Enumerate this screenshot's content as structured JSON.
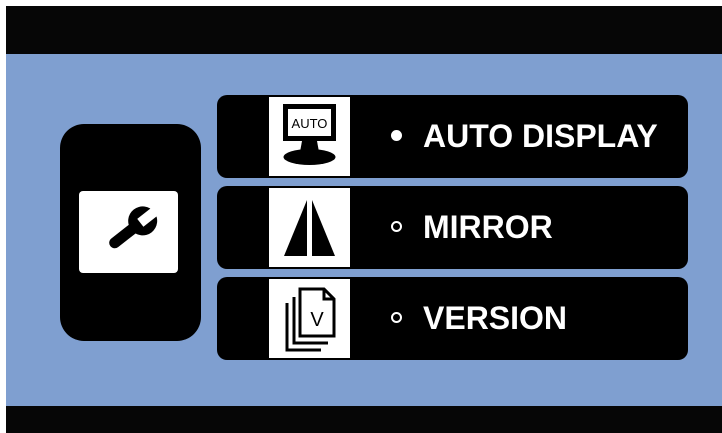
{
  "menu": {
    "items": [
      {
        "label": "AUTO DISPLAY",
        "icon": "auto-display-monitor-icon",
        "icon_text": "AUTO",
        "selected": true
      },
      {
        "label": "MIRROR",
        "icon": "mirror-icon",
        "selected": false
      },
      {
        "label": "VERSION",
        "icon": "version-document-icon",
        "icon_text": "V",
        "selected": false
      }
    ]
  },
  "sidebar": {
    "icon": "wrench-icon"
  },
  "colors": {
    "background": "#7f9fd0",
    "panel": "#000000",
    "text": "#ffffff"
  }
}
